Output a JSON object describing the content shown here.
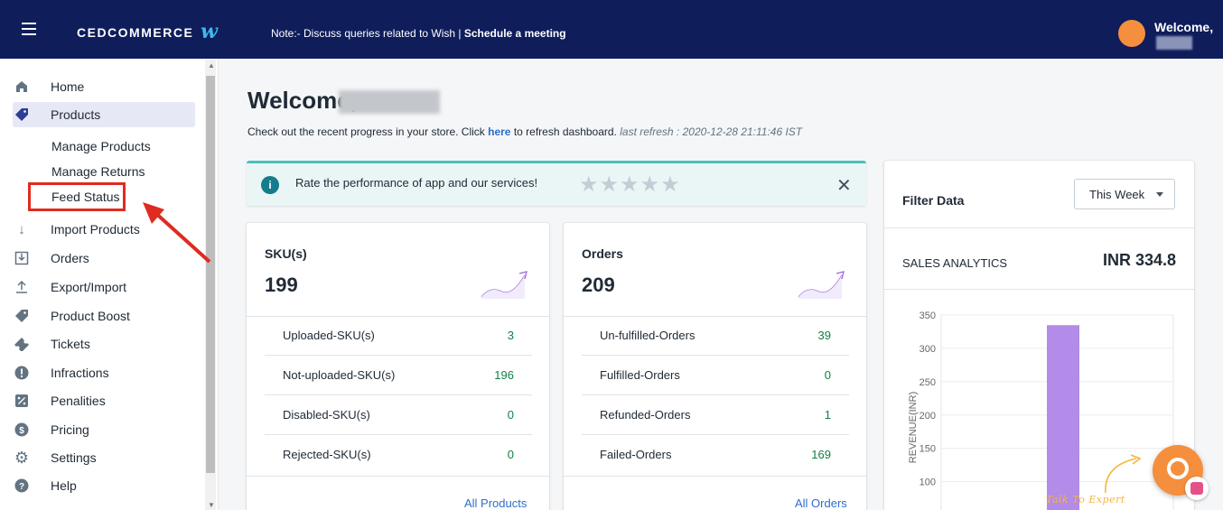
{
  "header": {
    "brand": "CEDCOMMERCE",
    "brand_mark": "w",
    "note_prefix": "Note:- Discuss queries related to Wish | ",
    "note_link": "Schedule a meeting",
    "welcome": "Welcome,"
  },
  "sidebar": {
    "items": [
      {
        "label": "Home",
        "icon": "home-icon"
      },
      {
        "label": "Products",
        "icon": "tag-icon"
      },
      {
        "label": "Import Products",
        "icon": "arrow-down-icon"
      },
      {
        "label": "Orders",
        "icon": "inbox-download-icon"
      },
      {
        "label": "Export/Import",
        "icon": "upload-icon"
      },
      {
        "label": "Product Boost",
        "icon": "tag-icon"
      },
      {
        "label": "Tickets",
        "icon": "ticket-icon"
      },
      {
        "label": "Infractions",
        "icon": "alert-icon"
      },
      {
        "label": "Penalities",
        "icon": "percent-icon"
      },
      {
        "label": "Pricing",
        "icon": "dollar-icon"
      },
      {
        "label": "Settings",
        "icon": "gear-icon"
      },
      {
        "label": "Help",
        "icon": "help-icon"
      }
    ],
    "sub_items": [
      "Manage Products",
      "Manage Returns",
      "Feed Status"
    ]
  },
  "main": {
    "welcome": "Welcome, ",
    "info_prefix": "Check out the recent progress in your store. Click ",
    "info_link": "here",
    "info_suffix": " to refresh dashboard. ",
    "last_refresh": "last refresh : 2020-12-28 21:11:46 IST",
    "rate_text": "Rate the performance of app and our services!",
    "rate_stars": 5
  },
  "sku_card": {
    "title": "SKU(s)",
    "total": "199",
    "rows": [
      {
        "label": "Uploaded-SKU(s)",
        "value": "3"
      },
      {
        "label": "Not-uploaded-SKU(s)",
        "value": "196"
      },
      {
        "label": "Disabled-SKU(s)",
        "value": "0"
      },
      {
        "label": "Rejected-SKU(s)",
        "value": "0"
      }
    ],
    "link": "All Products"
  },
  "orders_card": {
    "title": "Orders",
    "total": "209",
    "rows": [
      {
        "label": "Un-fulfilled-Orders",
        "value": "39"
      },
      {
        "label": "Fulfilled-Orders",
        "value": "0"
      },
      {
        "label": "Refunded-Orders",
        "value": "1"
      },
      {
        "label": "Failed-Orders",
        "value": "169"
      }
    ],
    "link": "All Orders"
  },
  "filter": {
    "title": "Filter Data",
    "select": "This Week",
    "sales_label": "SALES ANALYTICS",
    "sales_value": "INR 334.8"
  },
  "chart_data": {
    "type": "bar",
    "ylabel": "REVENUE(INR)",
    "yticks": [
      50,
      100,
      150,
      200,
      250,
      300,
      350
    ],
    "ylim": [
      40,
      350
    ],
    "values": [
      334.8
    ],
    "color": "#b38be8"
  },
  "chat": {
    "label": "Talk To Expert"
  }
}
